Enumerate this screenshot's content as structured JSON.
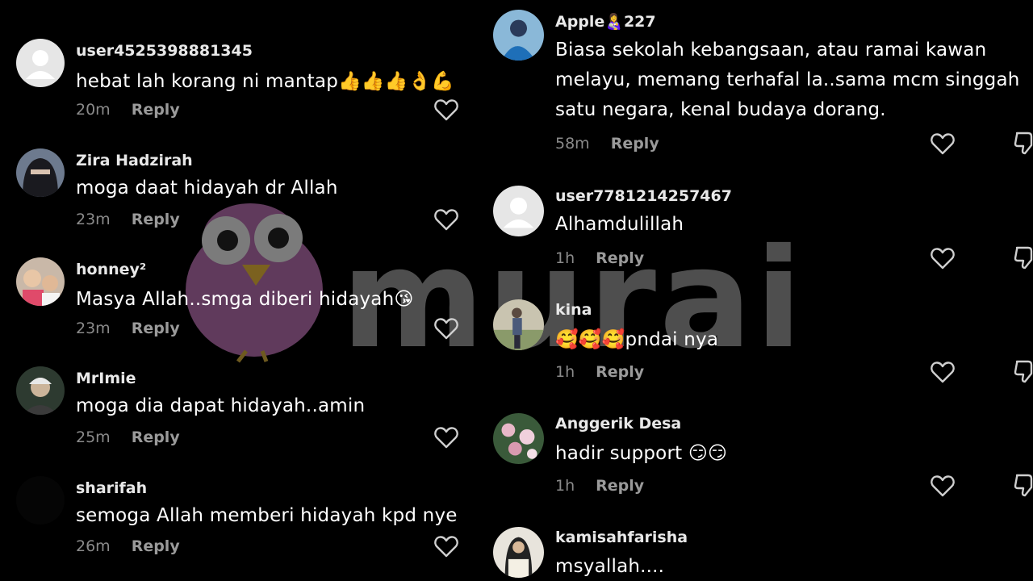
{
  "watermark": {
    "text": "murai"
  },
  "left_comments": [
    {
      "username": "user4525398881345",
      "text": "hebat lah korang ni mantap👍👍👍👌💪",
      "time": "20m",
      "reply": "Reply",
      "avatar": "default-avatar"
    },
    {
      "username": "Zira Hadzirah",
      "text": "moga daat hidayah dr Allah",
      "time": "23m",
      "reply": "Reply",
      "avatar": "hijab-avatar"
    },
    {
      "username": "honney²",
      "text": "Masya Allah..smga diberi hidayah😘",
      "time": "23m",
      "reply": "Reply",
      "avatar": "kids-avatar"
    },
    {
      "username": "MrImie",
      "text": "moga dia dapat hidayah..amin",
      "time": "25m",
      "reply": "Reply",
      "avatar": "person-avatar"
    },
    {
      "username": "sharifah",
      "text": "semoga Allah memberi hidayah kpd nye",
      "time": "26m",
      "reply": "Reply",
      "avatar": "black-avatar"
    }
  ],
  "right_comments": [
    {
      "username": "Apple👩‍🍼227",
      "text": "Biasa sekolah kebangsaan, atau ramai kawan melayu, memang terhafal la..sama mcm singgah satu negara, kenal budaya dorang.",
      "time": "58m",
      "reply": "Reply",
      "avatar": "blue-avatar"
    },
    {
      "username": "user7781214257467",
      "text": "Alhamdulillah",
      "time": "1h",
      "reply": "Reply",
      "avatar": "default-avatar"
    },
    {
      "username": "kina",
      "text": "🥰🥰🥰pndai nya",
      "time": "1h",
      "reply": "Reply",
      "avatar": "field-avatar"
    },
    {
      "username": "Anggerik Desa",
      "text": "hadir support 😏😏",
      "time": "1h",
      "reply": "Reply",
      "avatar": "flower-avatar"
    },
    {
      "username": "kamisahfarisha",
      "text": "msyallah....",
      "time": "",
      "reply": "",
      "avatar": "hijab-white-avatar"
    }
  ]
}
